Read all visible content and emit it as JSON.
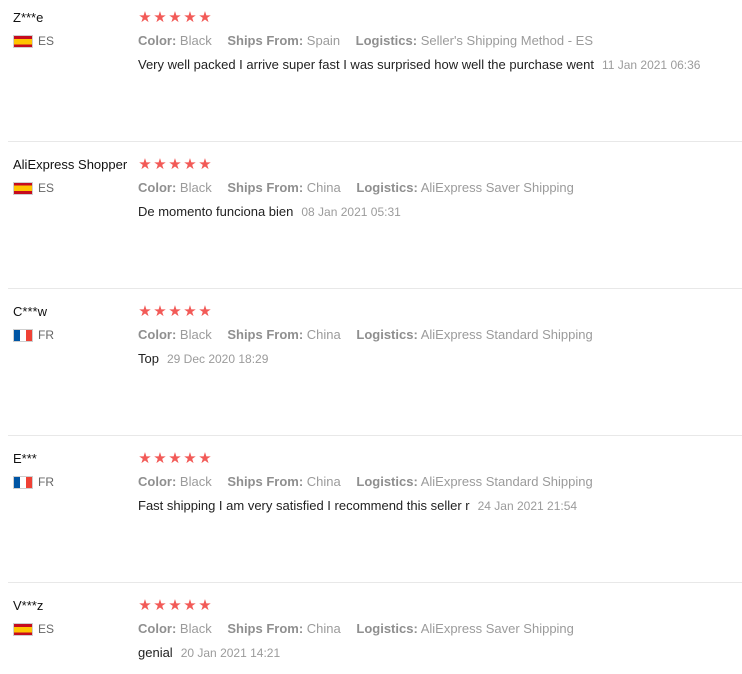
{
  "reviews": [
    {
      "user": "Z***e",
      "country": "ES",
      "flag": "spain-flag",
      "rating": 5,
      "color_label": "Color:",
      "color_value": "Black",
      "ships_label": "Ships From:",
      "ships_value": "Spain",
      "logistics_label": "Logistics:",
      "logistics_value": "Seller's Shipping Method - ES",
      "text": "Very well packed I arrive super fast I was surprised how well the purchase went",
      "date": "11 Jan 2021 06:36"
    },
    {
      "user": "AliExpress Shopper",
      "country": "ES",
      "flag": "spain-flag",
      "rating": 5,
      "color_label": "Color:",
      "color_value": "Black",
      "ships_label": "Ships From:",
      "ships_value": "China",
      "logistics_label": "Logistics:",
      "logistics_value": "AliExpress Saver Shipping",
      "text": "De momento funciona bien",
      "date": "08 Jan 2021 05:31"
    },
    {
      "user": "C***w",
      "country": "FR",
      "flag": "france-flag",
      "rating": 5,
      "color_label": "Color:",
      "color_value": "Black",
      "ships_label": "Ships From:",
      "ships_value": "China",
      "logistics_label": "Logistics:",
      "logistics_value": "AliExpress Standard Shipping",
      "text": "Top",
      "date": "29 Dec 2020 18:29"
    },
    {
      "user": "E***",
      "country": "FR",
      "flag": "france-flag",
      "rating": 5,
      "color_label": "Color:",
      "color_value": "Black",
      "ships_label": "Ships From:",
      "ships_value": "China",
      "logistics_label": "Logistics:",
      "logistics_value": "AliExpress Standard Shipping",
      "text": "Fast shipping I am very satisfied I recommend this seller r",
      "date": "24 Jan 2021 21:54"
    },
    {
      "user": "V***z",
      "country": "ES",
      "flag": "spain-flag",
      "rating": 5,
      "color_label": "Color:",
      "color_value": "Black",
      "ships_label": "Ships From:",
      "ships_value": "China",
      "logistics_label": "Logistics:",
      "logistics_value": "AliExpress Saver Shipping",
      "text": "genial",
      "date": "20 Jan 2021 14:21"
    }
  ],
  "colors": {
    "star": "#f25a57",
    "muted": "#9b9b9b",
    "divider": "#e8e8e8"
  }
}
